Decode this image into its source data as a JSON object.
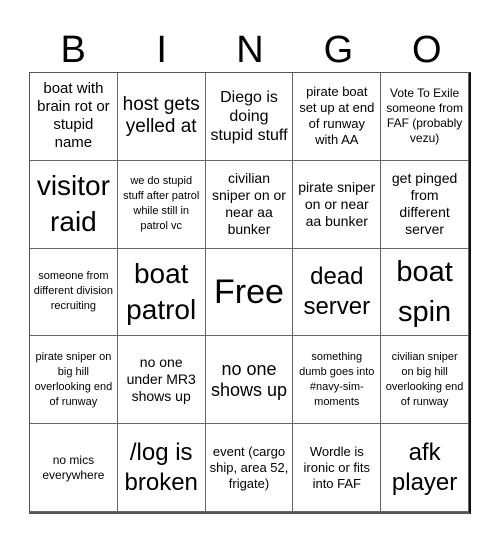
{
  "header": {
    "letters": [
      "B",
      "I",
      "N",
      "G",
      "O"
    ]
  },
  "cells": [
    [
      "boat with brain rot or stupid name",
      "host gets yelled at",
      "Diego is doing stupid stuff",
      "pirate boat set up at end of runway with AA",
      "Vote To Exile someone from FAF (probably vezu)"
    ],
    [
      "visitor raid",
      "we do stupid stuff after patrol while still in patrol vc",
      "civilian sniper on or near aa bunker",
      "pirate sniper on or near aa bunker",
      "get pinged from different server"
    ],
    [
      "someone from different division recruiting",
      "boat patrol",
      "Free",
      "dead server",
      "boat spin"
    ],
    [
      "pirate sniper on big hill overlooking end of runway",
      "no one under MR3 shows up",
      "no one shows up",
      "something dumb goes into #navy-sim-moments",
      "civilian sniper on big hill overlooking end of runway"
    ],
    [
      "no mics everywhere",
      "/log is broken",
      "event (cargo ship, area 52, frigate)",
      "Wordle is ironic or fits into FAF",
      "afk player"
    ]
  ]
}
